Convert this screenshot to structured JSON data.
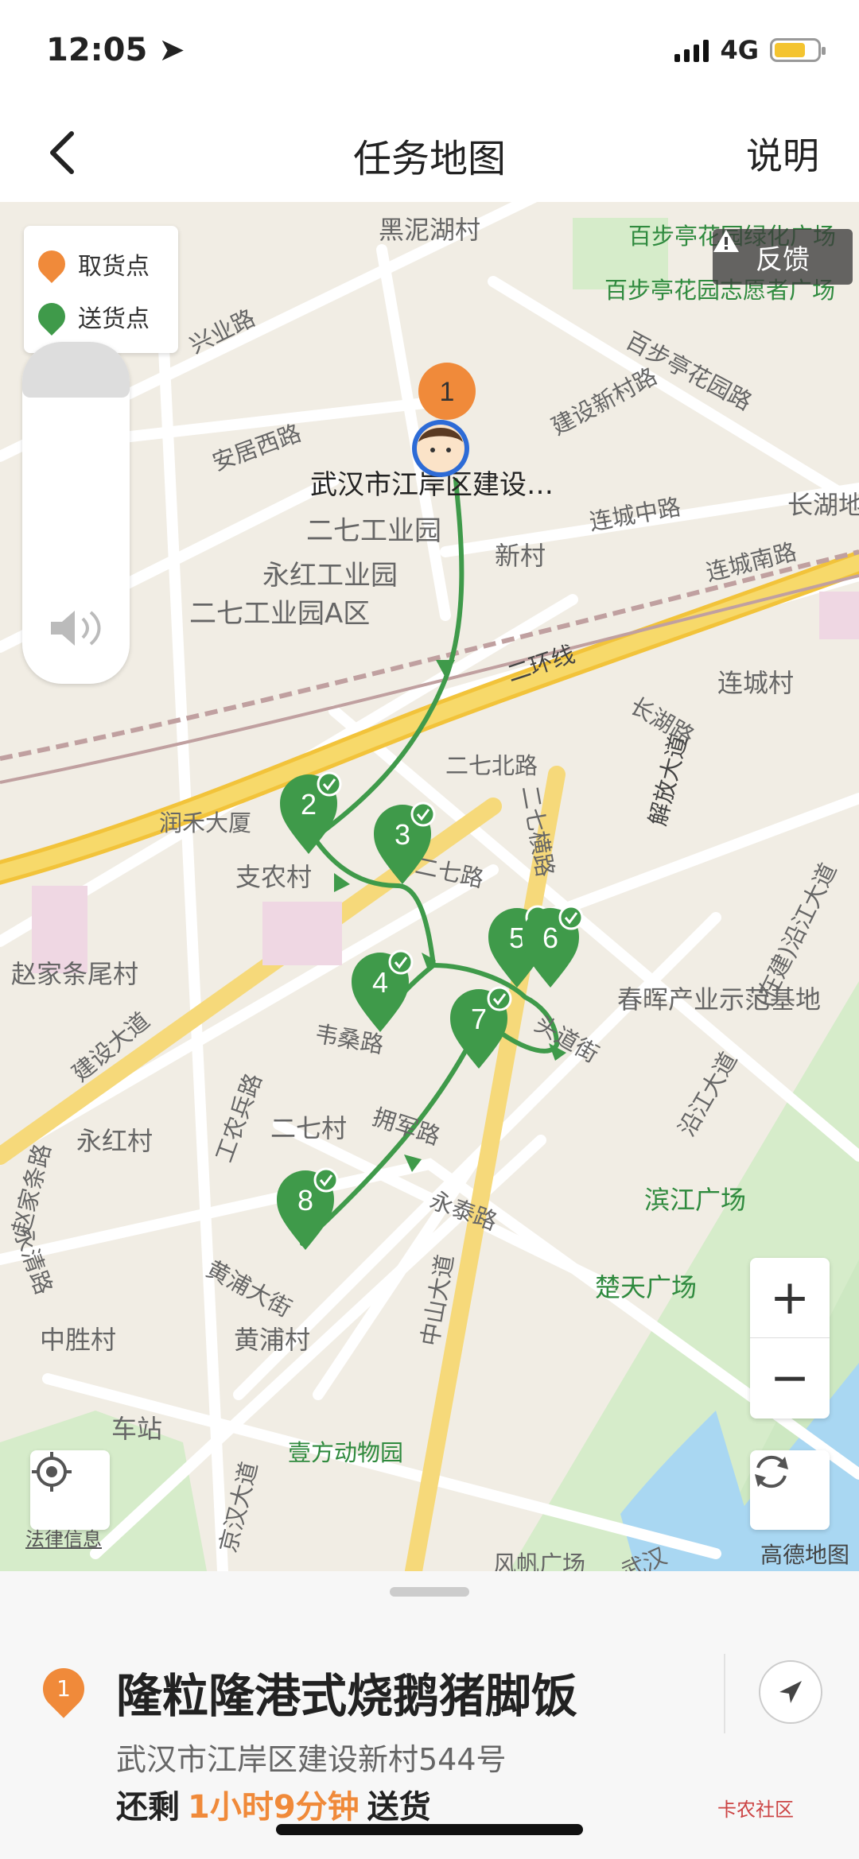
{
  "status_bar": {
    "time": "12:05",
    "network": "4G"
  },
  "nav": {
    "title": "任务地图",
    "help": "说明"
  },
  "legend": {
    "pickup": "取货点",
    "delivery": "送货点",
    "pickup_color": "#f08a3a",
    "delivery_color": "#3f9a4a"
  },
  "feedback_label": "反馈",
  "map_labels": [
    "黑泥湖村",
    "百步亭花园绿化广场",
    "百步亭花园志愿者广场",
    "兴业路",
    "百步亭花园路",
    "建设新村路",
    "安居西路",
    "江岸区建设…",
    "长湖地",
    "二七工业园",
    "新村",
    "连城中路",
    "永红工业园",
    "连城南路",
    "二七工业园A区",
    "二环线",
    "连城村",
    "长湖路",
    "二七北路",
    "解放大道",
    "润禾大厦",
    "二七横路",
    "支农村",
    "二七路",
    "(在建)沿江大道",
    "赵家条尾村",
    "春晖产业示范基地",
    "韦桑路",
    "头道街",
    "建设大道",
    "工农兵路",
    "二七村",
    "拥军路",
    "永红村",
    "永泰路",
    "滨江广场",
    "沿江大道",
    "黄浦大街",
    "楚天广场",
    "中山大道",
    "中胜村",
    "黄浦村",
    "车站",
    "壹方动物园",
    "京汉大道",
    "风帆广场",
    "武汉",
    "永清路",
    "赵家条路"
  ],
  "route_stops": {
    "start_label": "武汉市江岸区建设…",
    "pickup_number": "1",
    "delivery_numbers": [
      "2",
      "3",
      "4",
      "5",
      "6",
      "7",
      "8"
    ]
  },
  "zoom": {
    "in": "+",
    "out": "−"
  },
  "attribution_left": "法律信息",
  "attribution_right": "高德地图",
  "order": {
    "index": "1",
    "name": "隆粒隆港式烧鹅猪脚饭",
    "address": "武汉市江岸区建设新村544号",
    "remaining_prefix": "还剩",
    "remaining_time": "1小时9分钟",
    "remaining_suffix": "送货"
  },
  "watermark": "卡农社区"
}
